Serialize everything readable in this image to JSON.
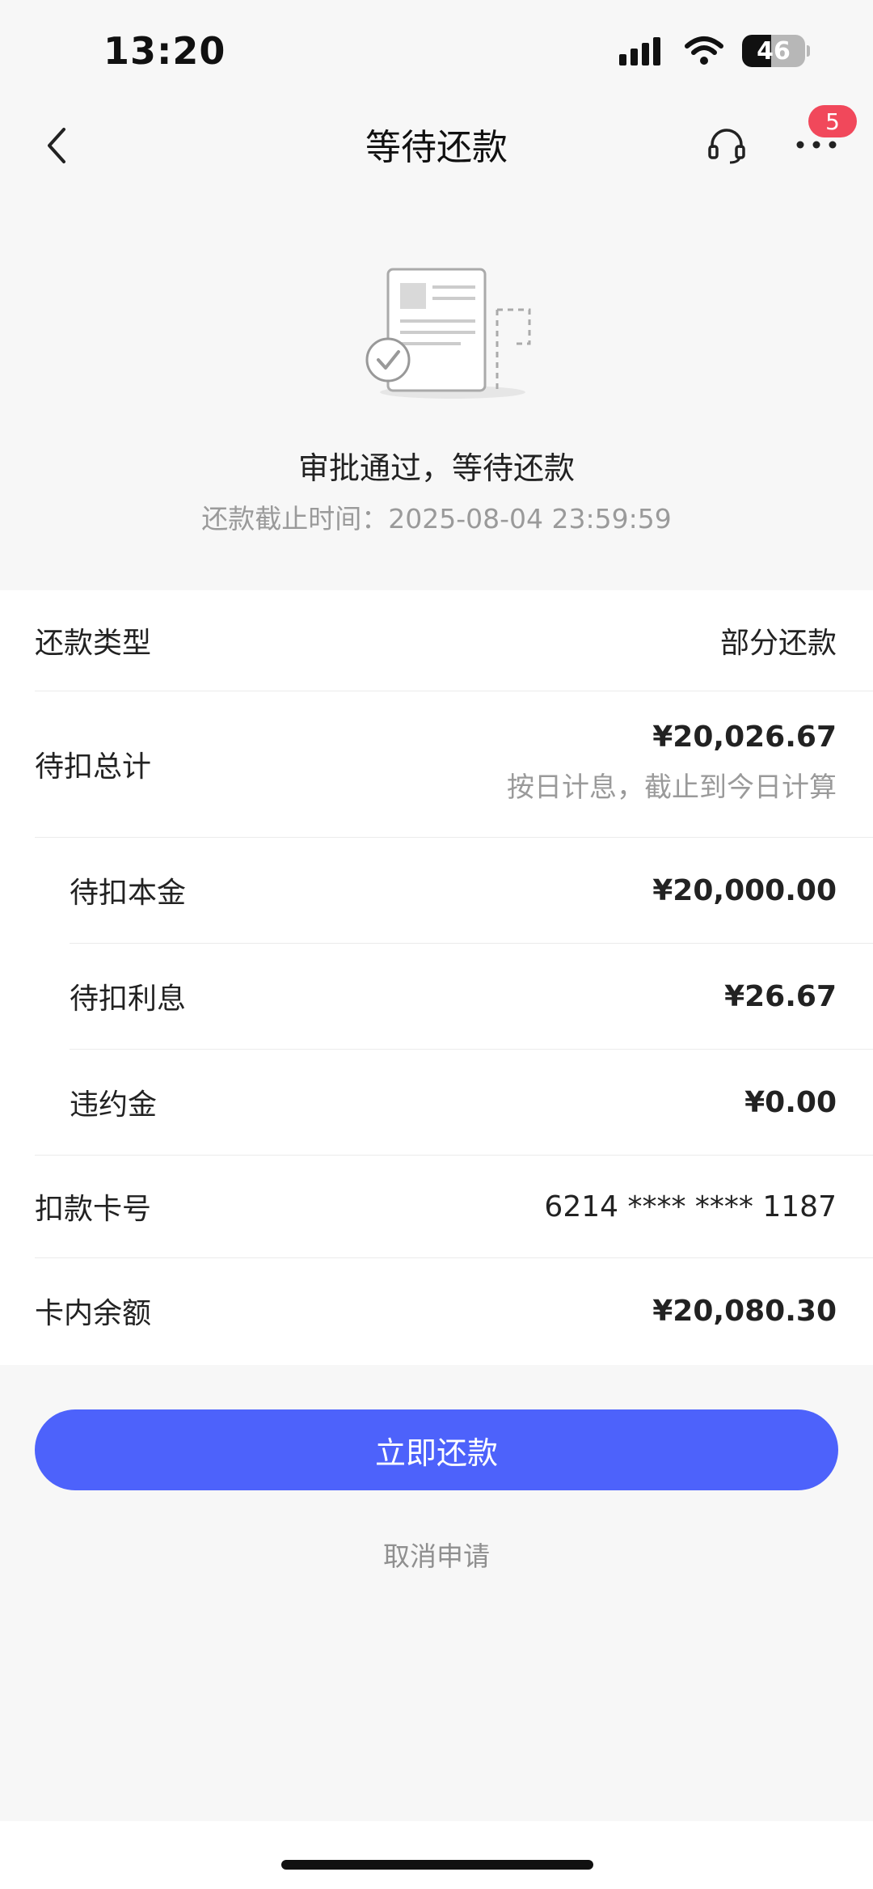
{
  "status_bar": {
    "time": "13:20",
    "battery_level": "46"
  },
  "nav": {
    "title": "等待还款",
    "badge_count": "5",
    "icons": {
      "back": "chevron-left-icon",
      "support": "headset-icon",
      "more": "more-dots-icon"
    }
  },
  "hero": {
    "title": "审批通过，等待还款",
    "deadline": "还款截止时间：2025-08-04 23:59:59"
  },
  "details": {
    "repay_type_label": "还款类型",
    "repay_type_value": "部分还款",
    "total_label": "待扣总计",
    "total_value": "¥20,026.67",
    "total_note": "按日计息，截止到今日计算",
    "principal_label": "待扣本金",
    "principal_value": "¥20,000.00",
    "interest_label": "待扣利息",
    "interest_value": "¥26.67",
    "penalty_label": "违约金",
    "penalty_value": "¥0.00",
    "card_label": "扣款卡号",
    "card_value": "6214 **** **** 1187",
    "balance_label": "卡内余额",
    "balance_value": "¥20,080.30"
  },
  "actions": {
    "repay_now": "立即还款",
    "cancel": "取消申请"
  },
  "colors": {
    "primary": "#4d62fb",
    "badge": "#f1485b",
    "background": "#f7f7f7"
  }
}
